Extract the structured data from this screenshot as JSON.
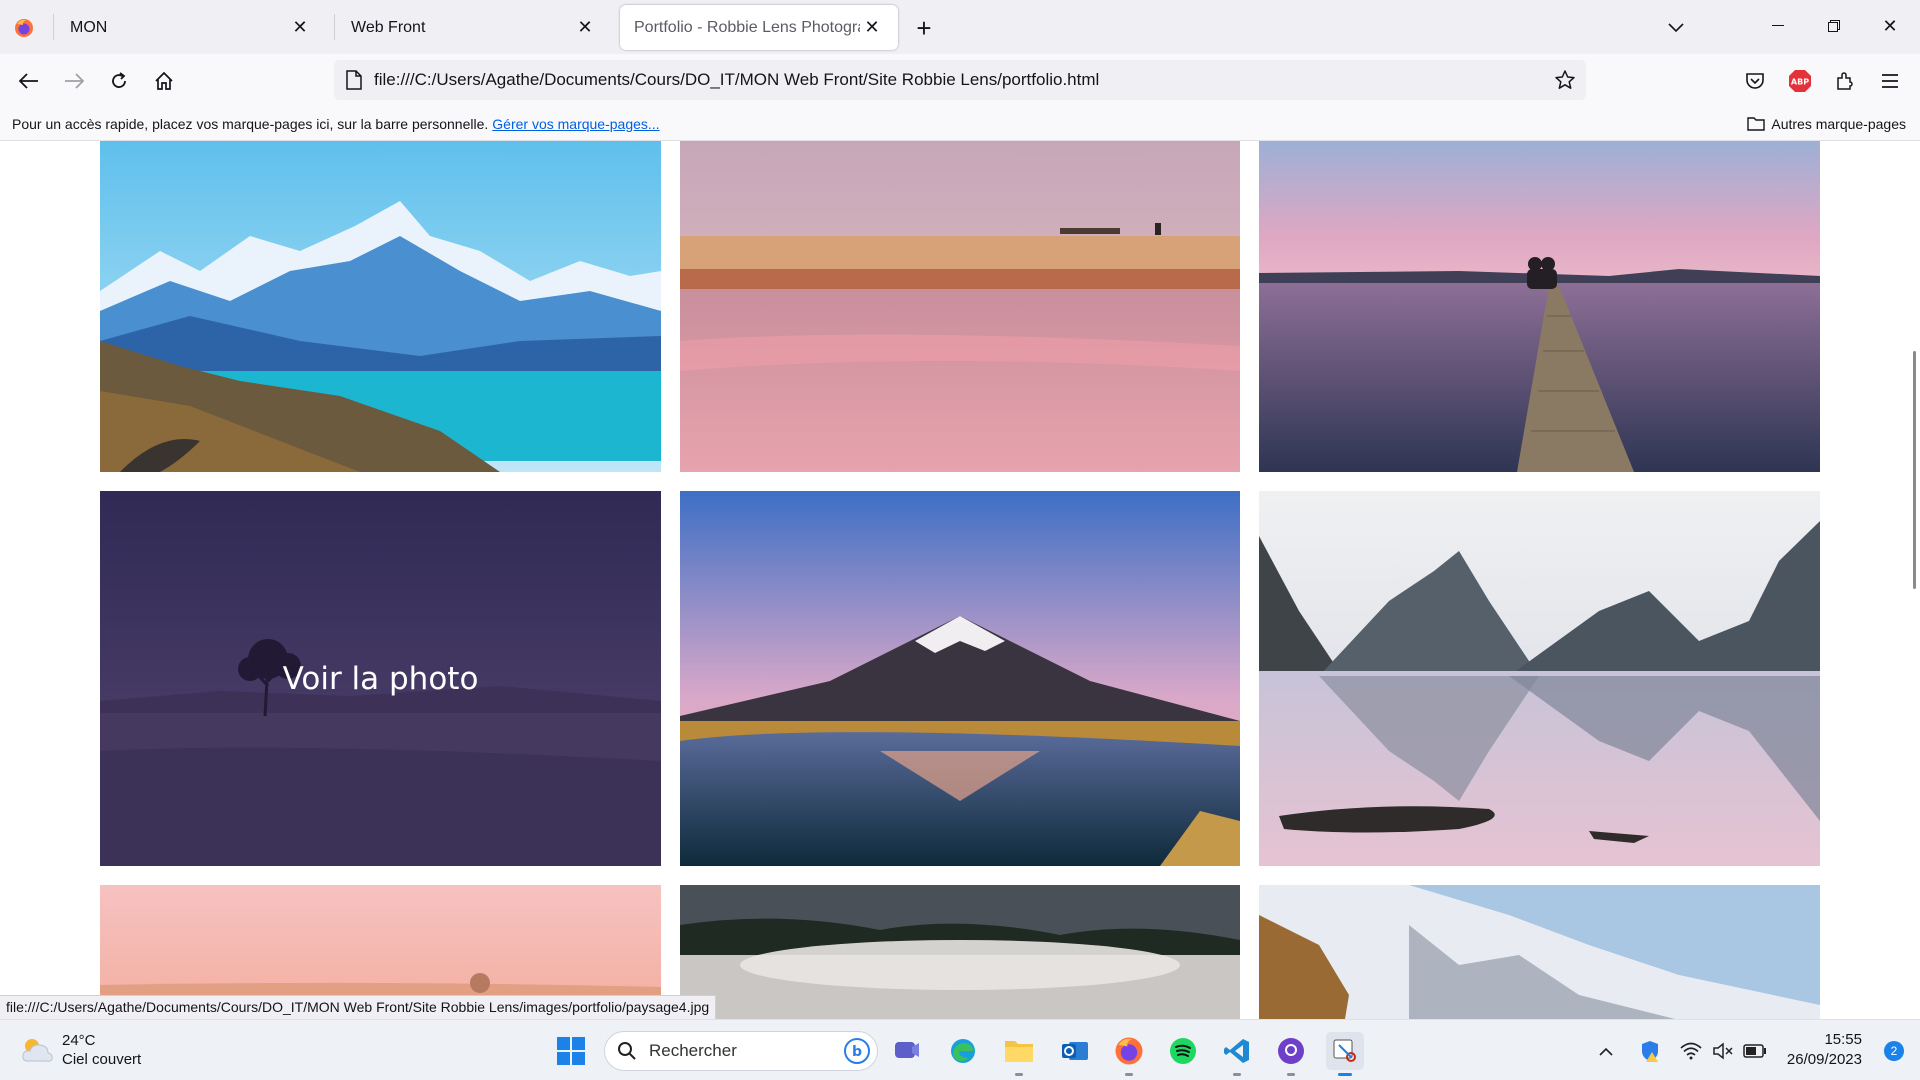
{
  "browser": {
    "tabs": [
      {
        "label": "MON"
      },
      {
        "label": "Web Front"
      },
      {
        "label": "Portfolio - Robbie Lens Photographe"
      }
    ],
    "url": "file:///C:/Users/Agathe/Documents/Cours/DO_IT/MON Web Front/Site Robbie Lens/portfolio.html",
    "bookmarks": {
      "hint": "Pour un accès rapide, placez vos marque-pages ici, sur la barre personnelle.",
      "manage_link": "Gérer vos marque-pages...",
      "other": "Autres marque-pages"
    },
    "status_url": "file:///C:/Users/Agathe/Documents/Cours/DO_IT/MON Web Front/Site Robbie Lens/images/portfolio/paysage4.jpg",
    "icons": [
      "firefox-icon",
      "back-icon",
      "forward-icon",
      "reload-icon",
      "home-icon",
      "page-icon",
      "star-icon",
      "pocket-icon",
      "adblock-icon",
      "extensions-icon",
      "menu-icon"
    ]
  },
  "page": {
    "hover_caption": "Voir la photo",
    "photos": [
      {
        "subject": "mountain-lake-turquoise"
      },
      {
        "subject": "beach-pink-reflection"
      },
      {
        "subject": "pier-couple-sunset"
      },
      {
        "subject": "lone-tree-lake-night"
      },
      {
        "subject": "volcano-reflection"
      },
      {
        "subject": "fjord-mountains-reflection"
      },
      {
        "subject": "pink-sky-coast"
      },
      {
        "subject": "geothermal-steam-forest"
      },
      {
        "subject": "snowy-mountain-slope"
      }
    ]
  },
  "taskbar": {
    "weather": {
      "temp": "24°C",
      "desc": "Ciel couvert"
    },
    "search_placeholder": "Rechercher",
    "time": "15:55",
    "date": "26/09/2023",
    "notification_count": "2"
  },
  "colors": {
    "accent": "#0061e0",
    "tabstrip": "#f0f0f4",
    "toolbar": "#f9f9fb"
  }
}
